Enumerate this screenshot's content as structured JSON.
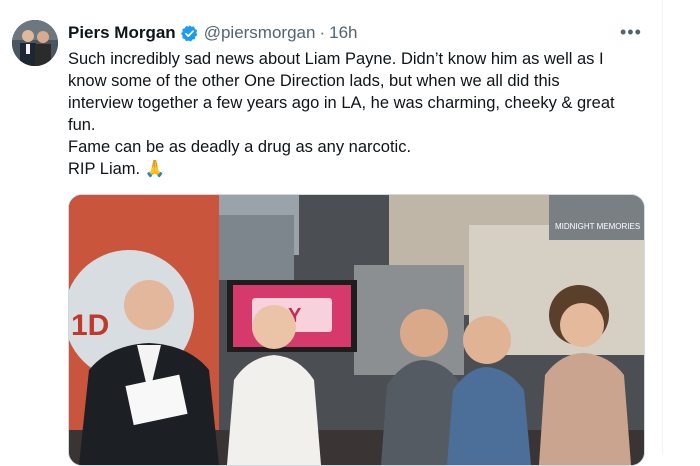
{
  "tweet": {
    "author_name": "Piers Morgan",
    "handle": "@piersmorgan",
    "separator": "·",
    "time": "16h",
    "more_label": "•••",
    "lines": [
      "Such incredibly sad news about Liam Payne. Didn’t know him as well as I know some of the other One Direction lads, but when we  all did this interview together a few years ago in LA, he was charming, cheeky & great fun.",
      "Fame can be as deadly a drug as any narcotic.",
      "RIP Liam. 🙏"
    ]
  },
  "media": {
    "logo_text": "1D",
    "screen_text": "DAY",
    "poster_text": "MIDNIGHT MEMORIES"
  },
  "colors": {
    "verified": "#1d9bf0",
    "text": "#0f1419",
    "muted": "#536471",
    "border": "#cfd9de"
  },
  "icons": {
    "verified": "verified-badge-icon",
    "more": "more-icon"
  }
}
